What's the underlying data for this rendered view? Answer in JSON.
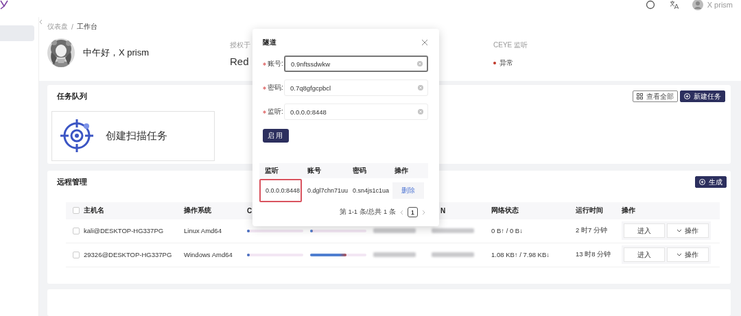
{
  "topbar": {
    "user_name": "X prism"
  },
  "sidebar": {
    "items": [
      {
        "selected": true
      }
    ]
  },
  "breadcrumb": {
    "items": [
      "仪表盘",
      "工作台"
    ],
    "separator": "/"
  },
  "header": {
    "greeting": "中午好，X prism",
    "license_label": "授权于",
    "license_value": "Red",
    "ceye_label": "CEYE 监听",
    "ceye_status": {
      "text": "异常",
      "kind": "error"
    }
  },
  "task_queue": {
    "title": "任务队列",
    "buttons": [
      {
        "label": "查看全部",
        "kind": "secondary"
      },
      {
        "label": "新建任务",
        "kind": "primary"
      }
    ],
    "create_card": {
      "label": "创建扫描任务"
    }
  },
  "remote": {
    "title": "远程管理",
    "button": {
      "label": "生成"
    },
    "table": {
      "header_checkbox": {
        "checked": false
      },
      "columns": [
        "主机名",
        "操作系统",
        "C",
        "N",
        "网络状态",
        "运行时间",
        "操作"
      ],
      "rows": [
        {
          "checked": false,
          "host": "kali@DESKTOP-HG337PG",
          "os": "Linux Amd64",
          "cpu": {
            "level": 0.02
          },
          "memory": {
            "level": 0.03
          },
          "network": "0 B↑ / 0 B↓",
          "uptime": "2 时7 分钟",
          "actions": [
            "进入",
            "操作"
          ]
        },
        {
          "checked": false,
          "host": "29326@DESKTOP-HG337PG",
          "os": "Windows Amd64",
          "cpu": {
            "level": 0.02
          },
          "memory": {
            "level": 0.65
          },
          "network": "1.08 KB↑ / 7.98 KB↓",
          "uptime": "13 时8 分钟",
          "actions": [
            "进入",
            "操作"
          ]
        }
      ]
    }
  },
  "modal": {
    "title": "隧道",
    "fields": [
      {
        "label": "账号:",
        "value": "0.9nftssdwkw",
        "required": true,
        "focused": true
      },
      {
        "label": "密码:",
        "value": "0.7q8gfgcpbcl",
        "required": true,
        "focused": false
      },
      {
        "label": "监听:",
        "value": "0.0.0.0:8448",
        "required": true,
        "focused": false
      }
    ],
    "submit": "启用",
    "table": {
      "columns": [
        "监听",
        "账号",
        "密码",
        "操作"
      ],
      "rows": [
        {
          "listen": "0.0.0.0:8448",
          "account": "0.dgl7chn71uu",
          "password": "0.sn4js1c1ua",
          "action": "删除",
          "highlighted": true
        }
      ]
    },
    "pagination": {
      "summary": "第 1-1 条/总共 1 条",
      "pages": [
        {
          "label": "1",
          "selected": true
        }
      ]
    }
  }
}
